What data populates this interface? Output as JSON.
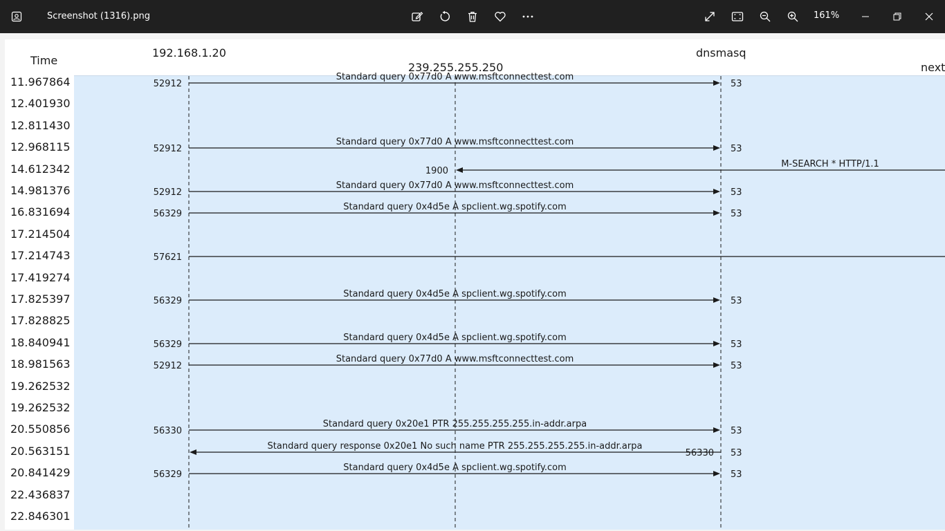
{
  "app": {
    "title": "Screenshot (1316).png",
    "zoom": "161%"
  },
  "toolbar": {
    "left_icon": "photos-app-icon",
    "icons": [
      "edit-icon",
      "rotate-icon",
      "delete-icon",
      "favorite-icon",
      "more-icon"
    ],
    "right_icons": [
      "fullscreen-icon",
      "fit-icon",
      "zoom-out-icon",
      "zoom-in-icon"
    ],
    "window_controls": [
      "minimize-icon",
      "restore-icon",
      "close-icon"
    ]
  },
  "flow": {
    "time_header": "Time",
    "hosts": [
      {
        "label": "192.168.1.20"
      },
      {
        "label": "239.255.255.250"
      },
      {
        "label": "dnsmasq"
      },
      {
        "label": "next"
      }
    ],
    "rows": [
      {
        "time": "11.967864",
        "src_port": "52912",
        "dst_port": "53",
        "text": "Standard query 0x77d0 A www.msftconnecttest.com",
        "from": 0,
        "to": 2
      },
      {
        "time": "12.401930"
      },
      {
        "time": "12.811430"
      },
      {
        "time": "12.968115",
        "src_port": "52912",
        "dst_port": "53",
        "text": "Standard query 0x77d0 A www.msftconnecttest.com",
        "from": 0,
        "to": 2
      },
      {
        "time": "14.612342",
        "src_port": "1900",
        "text": "M-SEARCH * HTTP/1.1",
        "from": 3,
        "to": 1
      },
      {
        "time": "14.981376",
        "src_port": "52912",
        "dst_port": "53",
        "text": "Standard query 0x77d0 A www.msftconnecttest.com",
        "from": 0,
        "to": 2
      },
      {
        "time": "16.831694",
        "src_port": "56329",
        "dst_port": "53",
        "text": "Standard query 0x4d5e A spclient.wg.spotify.com",
        "from": 0,
        "to": 2
      },
      {
        "time": "17.214504"
      },
      {
        "time": "17.214743",
        "src_port": "57621",
        "text": "",
        "from": 0,
        "to": 3
      },
      {
        "time": "17.419274"
      },
      {
        "time": "17.825397",
        "src_port": "56329",
        "dst_port": "53",
        "text": "Standard query 0x4d5e A spclient.wg.spotify.com",
        "from": 0,
        "to": 2
      },
      {
        "time": "17.828825"
      },
      {
        "time": "18.840941",
        "src_port": "56329",
        "dst_port": "53",
        "text": "Standard query 0x4d5e A spclient.wg.spotify.com",
        "from": 0,
        "to": 2
      },
      {
        "time": "18.981563",
        "src_port": "52912",
        "dst_port": "53",
        "text": "Standard query 0x77d0 A www.msftconnecttest.com",
        "from": 0,
        "to": 2
      },
      {
        "time": "19.262532"
      },
      {
        "time": "19.262532"
      },
      {
        "time": "20.550856",
        "src_port": "56330",
        "dst_port": "53",
        "text": "Standard query 0x20e1 PTR 255.255.255.255.in-addr.arpa",
        "from": 0,
        "to": 2
      },
      {
        "time": "20.563151",
        "src_port": "56330",
        "dst_port": "53",
        "text": "Standard query response 0x20e1 No such name PTR 255.255.255.255.in-addr.arpa",
        "from": 2,
        "to": 0
      },
      {
        "time": "20.841429",
        "src_port": "56329",
        "dst_port": "53",
        "text": "Standard query 0x4d5e A spclient.wg.spotify.com",
        "from": 0,
        "to": 2
      },
      {
        "time": "22.436837"
      },
      {
        "time": "22.846301"
      }
    ]
  },
  "colors": {
    "titlebar": "#202020",
    "plot_bg": "#dcecfb",
    "line": "#1a1a1a"
  }
}
